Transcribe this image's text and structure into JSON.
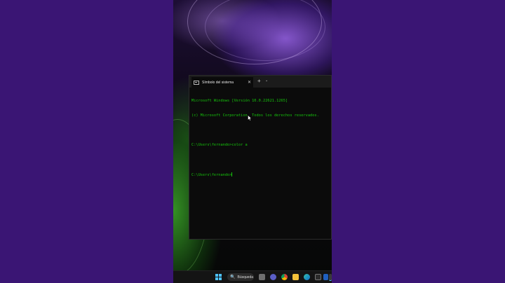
{
  "window": {
    "tab_title": "Símbolo del sistema",
    "close_glyph": "✕",
    "new_tab_glyph": "+",
    "dropdown_glyph": "⌄"
  },
  "console": {
    "lines": [
      "Microsoft Windows [Versión 10.0.22621.1265]",
      "(c) Microsoft Corporation. Todos los derechos reservados.",
      "",
      "C:\\Users\\fernando>color a",
      "",
      "C:\\Users\\fernando>"
    ],
    "text_color": "#16c60c"
  },
  "taskbar": {
    "search_label": "Búsqueda",
    "search_icon": "🔍",
    "icons": [
      "task-view-icon",
      "chrome-icon",
      "file-explorer-icon",
      "edge-icon",
      "store-icon",
      "mail-icon",
      "word-icon",
      "terminal-icon"
    ]
  },
  "colors": {
    "side_background": "#3a1574",
    "console_background": "#0b0b0b",
    "accent": "#4cc2ff"
  }
}
